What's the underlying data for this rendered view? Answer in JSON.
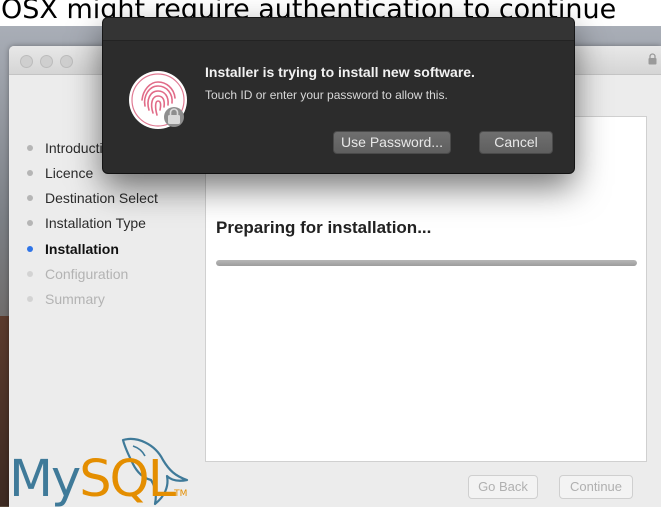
{
  "caption": "OSX might require authentication to continue",
  "installer": {
    "steps": [
      {
        "label": "Introduction",
        "state": "done"
      },
      {
        "label": "Licence",
        "state": "done"
      },
      {
        "label": "Destination Select",
        "state": "done"
      },
      {
        "label": "Installation Type",
        "state": "done"
      },
      {
        "label": "Installation",
        "state": "current"
      },
      {
        "label": "Configuration",
        "state": "future"
      },
      {
        "label": "Summary",
        "state": "future"
      }
    ],
    "status_text": "Preparing for installation...",
    "progress_fraction": 1.0,
    "buttons": {
      "go_back": "Go Back",
      "continue": "Continue"
    },
    "logo": {
      "part1": "My",
      "part2": "SQL",
      "tm": "TM"
    }
  },
  "dialog": {
    "title": "Installer is trying to install new software.",
    "message": "Touch ID or enter your password to allow this.",
    "use_password_label": "Use Password...",
    "cancel_label": "Cancel",
    "icon": "fingerprint-icon"
  },
  "colors": {
    "accent": "#2f74e7",
    "mysql_blue": "#3f7a99",
    "mysql_orange": "#e48e00",
    "dialog_bg": "#2c2c2c"
  }
}
